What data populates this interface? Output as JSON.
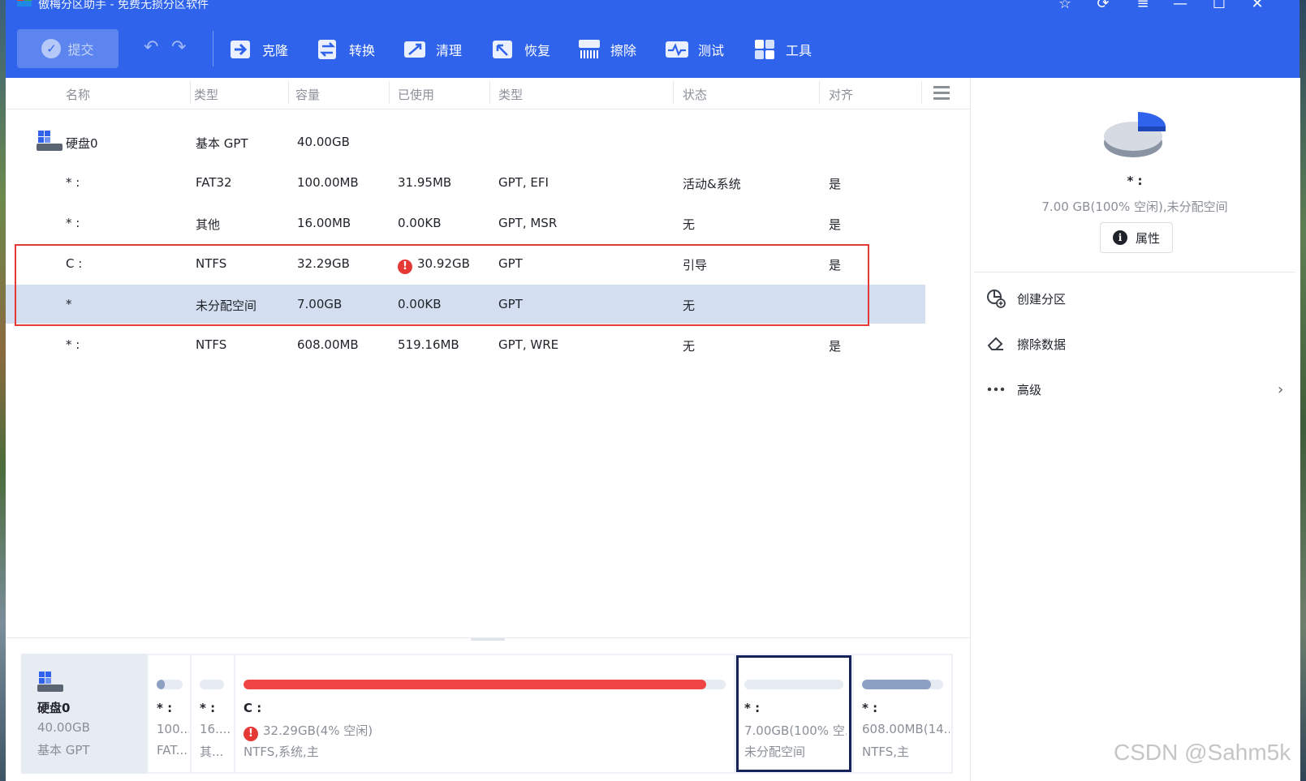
{
  "window": {
    "title": "傲梅分区助手 - 免费无损分区软件",
    "accent_color": "#2f63eb",
    "controls": [
      "star-icon",
      "refresh-icon",
      "menu-icon",
      "minimize-icon",
      "maximize-icon",
      "close-icon"
    ]
  },
  "toolbar": {
    "submit_label": "提交",
    "tools": [
      {
        "label": "克隆",
        "icon": "clone-icon"
      },
      {
        "label": "转换",
        "icon": "convert-icon"
      },
      {
        "label": "清理",
        "icon": "clean-icon"
      },
      {
        "label": "恢复",
        "icon": "recover-icon"
      },
      {
        "label": "擦除",
        "icon": "wipe-icon"
      },
      {
        "label": "测试",
        "icon": "test-icon"
      },
      {
        "label": "工具",
        "icon": "tools-icon"
      }
    ]
  },
  "table": {
    "columns": [
      "名称",
      "类型",
      "容量",
      "已使用",
      "类型",
      "状态",
      "对齐"
    ],
    "disk": {
      "name": "硬盘0",
      "type": "基本 GPT",
      "capacity": "40.00GB"
    },
    "rows": [
      {
        "name": "* :",
        "fs": "FAT32",
        "capacity": "100.00MB",
        "used": "31.95MB",
        "ptype": "GPT, EFI",
        "status": "活动&系统",
        "align": "是",
        "warn": false
      },
      {
        "name": "* :",
        "fs": "其他",
        "capacity": "16.00MB",
        "used": "0.00KB",
        "ptype": "GPT, MSR",
        "status": "无",
        "align": "是",
        "warn": false
      },
      {
        "name": "C :",
        "fs": "NTFS",
        "capacity": "32.29GB",
        "used": "30.92GB",
        "ptype": "GPT",
        "status": "引导",
        "align": "是",
        "warn": true
      },
      {
        "name": "*",
        "fs": "未分配空间",
        "capacity": "7.00GB",
        "used": "0.00KB",
        "ptype": "GPT",
        "status": "无",
        "align": "",
        "warn": false
      },
      {
        "name": "* :",
        "fs": "NTFS",
        "capacity": "608.00MB",
        "used": "519.16MB",
        "ptype": "GPT, WRE",
        "status": "无",
        "align": "是",
        "warn": false
      }
    ]
  },
  "diskmap": {
    "disk": {
      "name": "硬盘0",
      "size": "40.00GB",
      "type": "基本 GPT"
    },
    "partitions": [
      {
        "name": "* :",
        "line1": "100...",
        "line2": "FAT...",
        "used_fraction": 0.32,
        "bar_color": "#8ca0c4"
      },
      {
        "name": "* :",
        "line1": "16....",
        "line2": "其...",
        "used_fraction": 0.0,
        "bar_color": "#8ca0c4"
      },
      {
        "name": "C :",
        "line1": "32.29GB(4% 空闲)",
        "line2": "NTFS,系统,主",
        "used_fraction": 0.96,
        "bar_color": "#f04545"
      },
      {
        "name": "* :",
        "line1": "7.00GB(100% 空...",
        "line2": "未分配空间",
        "used_fraction": 0.0,
        "bar_color": "#8ca0c4"
      },
      {
        "name": "* :",
        "line1": "608.00MB(14...",
        "line2": "NTFS,主",
        "used_fraction": 0.85,
        "bar_color": "#8ca0c4"
      }
    ]
  },
  "side_panel": {
    "name": "* :",
    "detail": "7.00 GB(100% 空闲),未分配空间",
    "properties_label": "属性",
    "actions": [
      {
        "label": "创建分区",
        "icon": "create-partition-icon"
      },
      {
        "label": "擦除数据",
        "icon": "eraser-icon"
      },
      {
        "label": "高级",
        "icon": "more-icon"
      }
    ]
  },
  "watermark": "CSDN @Sahm5k"
}
